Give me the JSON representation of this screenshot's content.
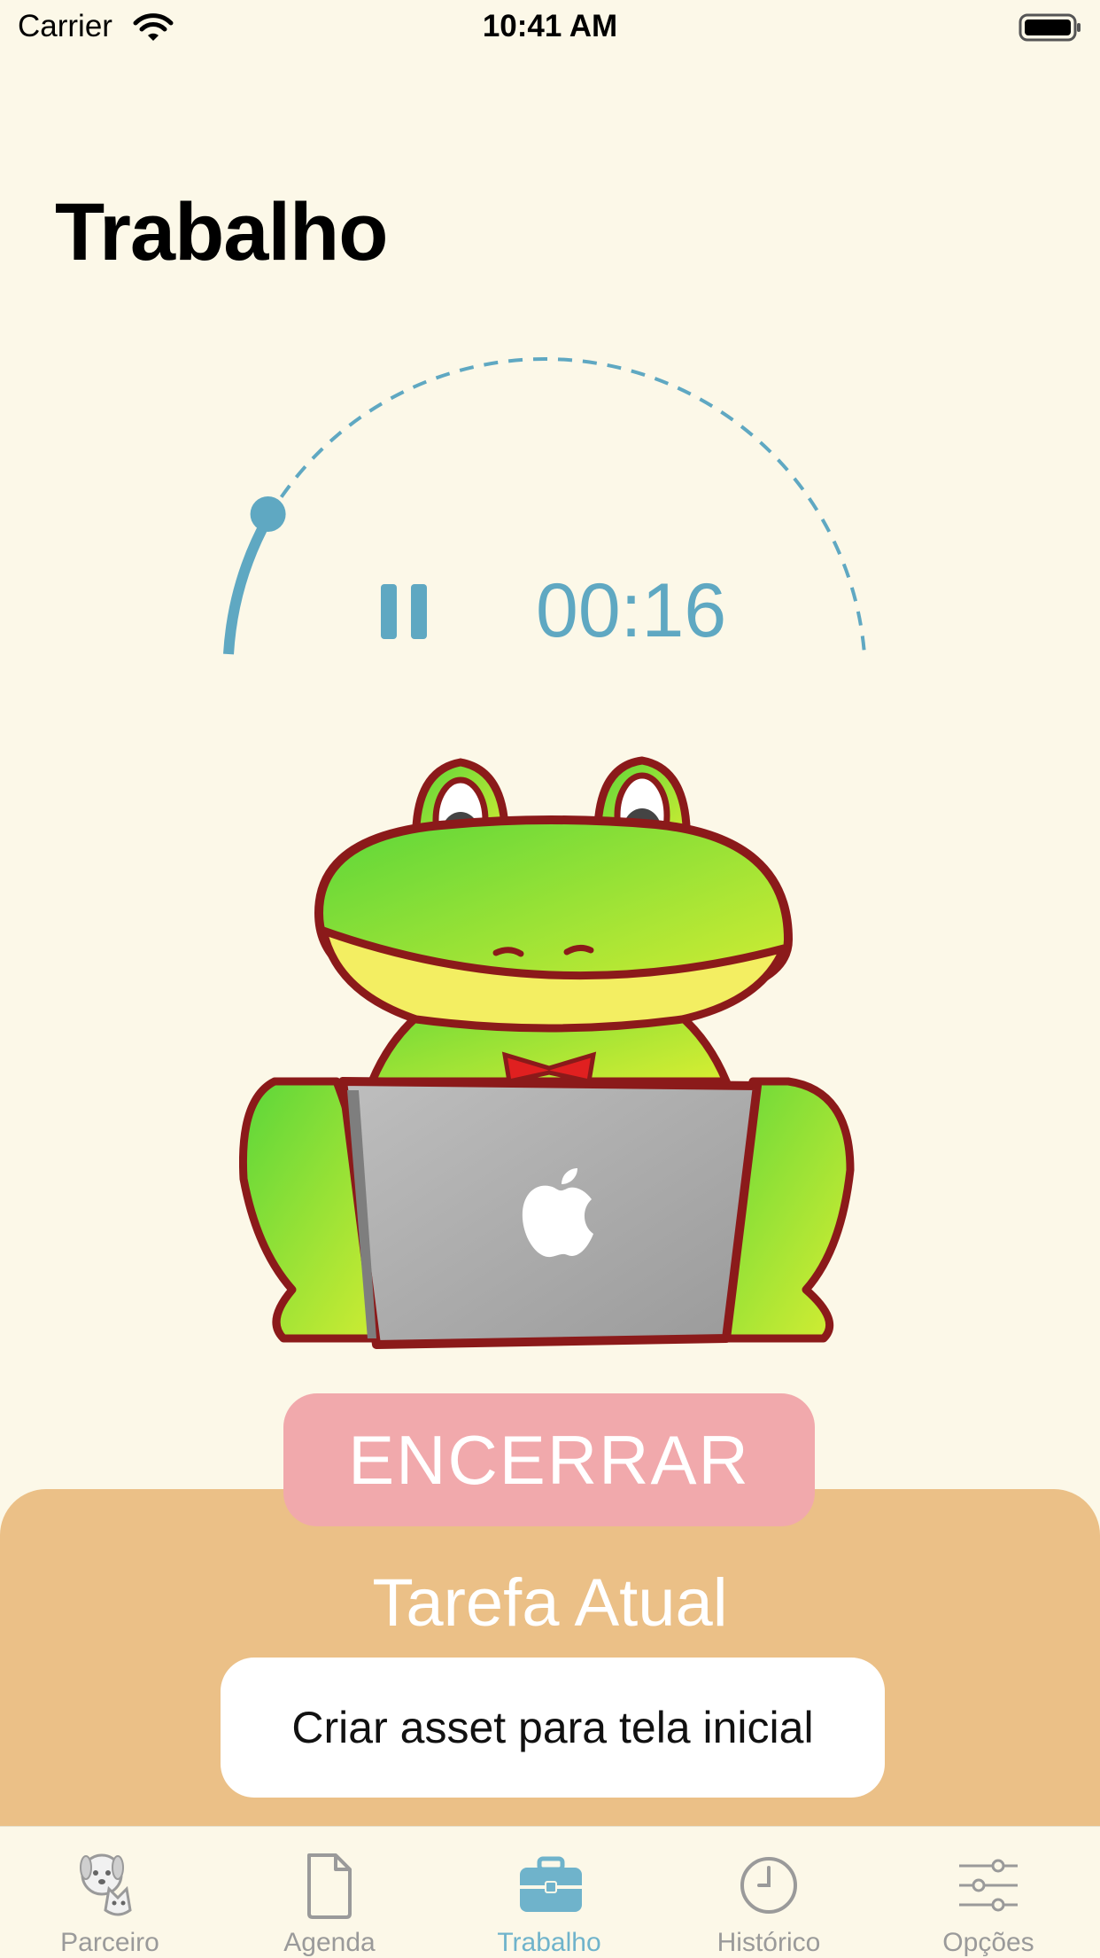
{
  "status_bar": {
    "carrier": "Carrier",
    "time": "10:41 AM"
  },
  "page": {
    "title": "Trabalho"
  },
  "timer": {
    "display": "00:16",
    "state_icon": "pause-icon",
    "progress": 0.06,
    "color": "#5FA8C2"
  },
  "end_button": {
    "label": "ENCERRAR",
    "color": "#F1A9AC"
  },
  "task_panel": {
    "heading": "Tarefa Atual",
    "current_task": "Criar asset para tela inicial",
    "color": "#EBC087"
  },
  "tab_bar": {
    "active_color": "#6FB3CB",
    "inactive_color": "#9A9A9A",
    "tabs": [
      {
        "label": "Parceiro",
        "icon": "pets-icon",
        "active": false
      },
      {
        "label": "Agenda",
        "icon": "document-icon",
        "active": false
      },
      {
        "label": "Trabalho",
        "icon": "briefcase-icon",
        "active": true
      },
      {
        "label": "Histórico",
        "icon": "clock-icon",
        "active": false
      },
      {
        "label": "Opções",
        "icon": "sliders-icon",
        "active": false
      }
    ]
  }
}
